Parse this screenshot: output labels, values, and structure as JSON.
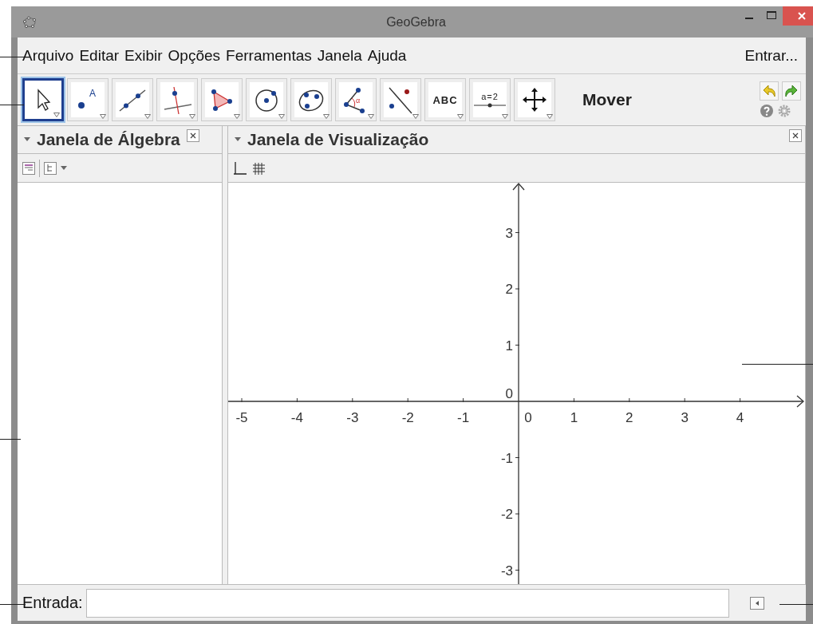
{
  "window": {
    "title": "GeoGebra"
  },
  "menu": {
    "items": [
      "Arquivo",
      "Editar",
      "Exibir",
      "Opções",
      "Ferramentas",
      "Janela",
      "Ajuda"
    ],
    "login": "Entrar..."
  },
  "toolbar": {
    "tools": [
      {
        "kind": "move",
        "selected": true
      },
      {
        "kind": "point",
        "label": "A",
        "selected": false
      },
      {
        "kind": "line",
        "selected": false
      },
      {
        "kind": "perpendicular",
        "selected": false
      },
      {
        "kind": "polygon",
        "selected": false
      },
      {
        "kind": "circle",
        "selected": false
      },
      {
        "kind": "conic",
        "selected": false
      },
      {
        "kind": "angle",
        "label": "α",
        "selected": false
      },
      {
        "kind": "reflect",
        "selected": false
      },
      {
        "kind": "text",
        "label": "ABC",
        "selected": false
      },
      {
        "kind": "slider",
        "label": "a=2",
        "selected": false
      },
      {
        "kind": "pan",
        "selected": false
      }
    ],
    "tool_name": "Mover"
  },
  "algebra_panel": {
    "title": "Janela de Álgebra"
  },
  "graphics_panel": {
    "title": "Janela de Visualização",
    "x_ticks": [
      "-5",
      "-4",
      "-3",
      "-2",
      "-1",
      "0",
      "1",
      "2",
      "3",
      "4"
    ],
    "y_ticks": [
      "3",
      "2",
      "1",
      "0",
      "-1",
      "-2",
      "-3"
    ]
  },
  "input_bar": {
    "label": "Entrada:"
  }
}
